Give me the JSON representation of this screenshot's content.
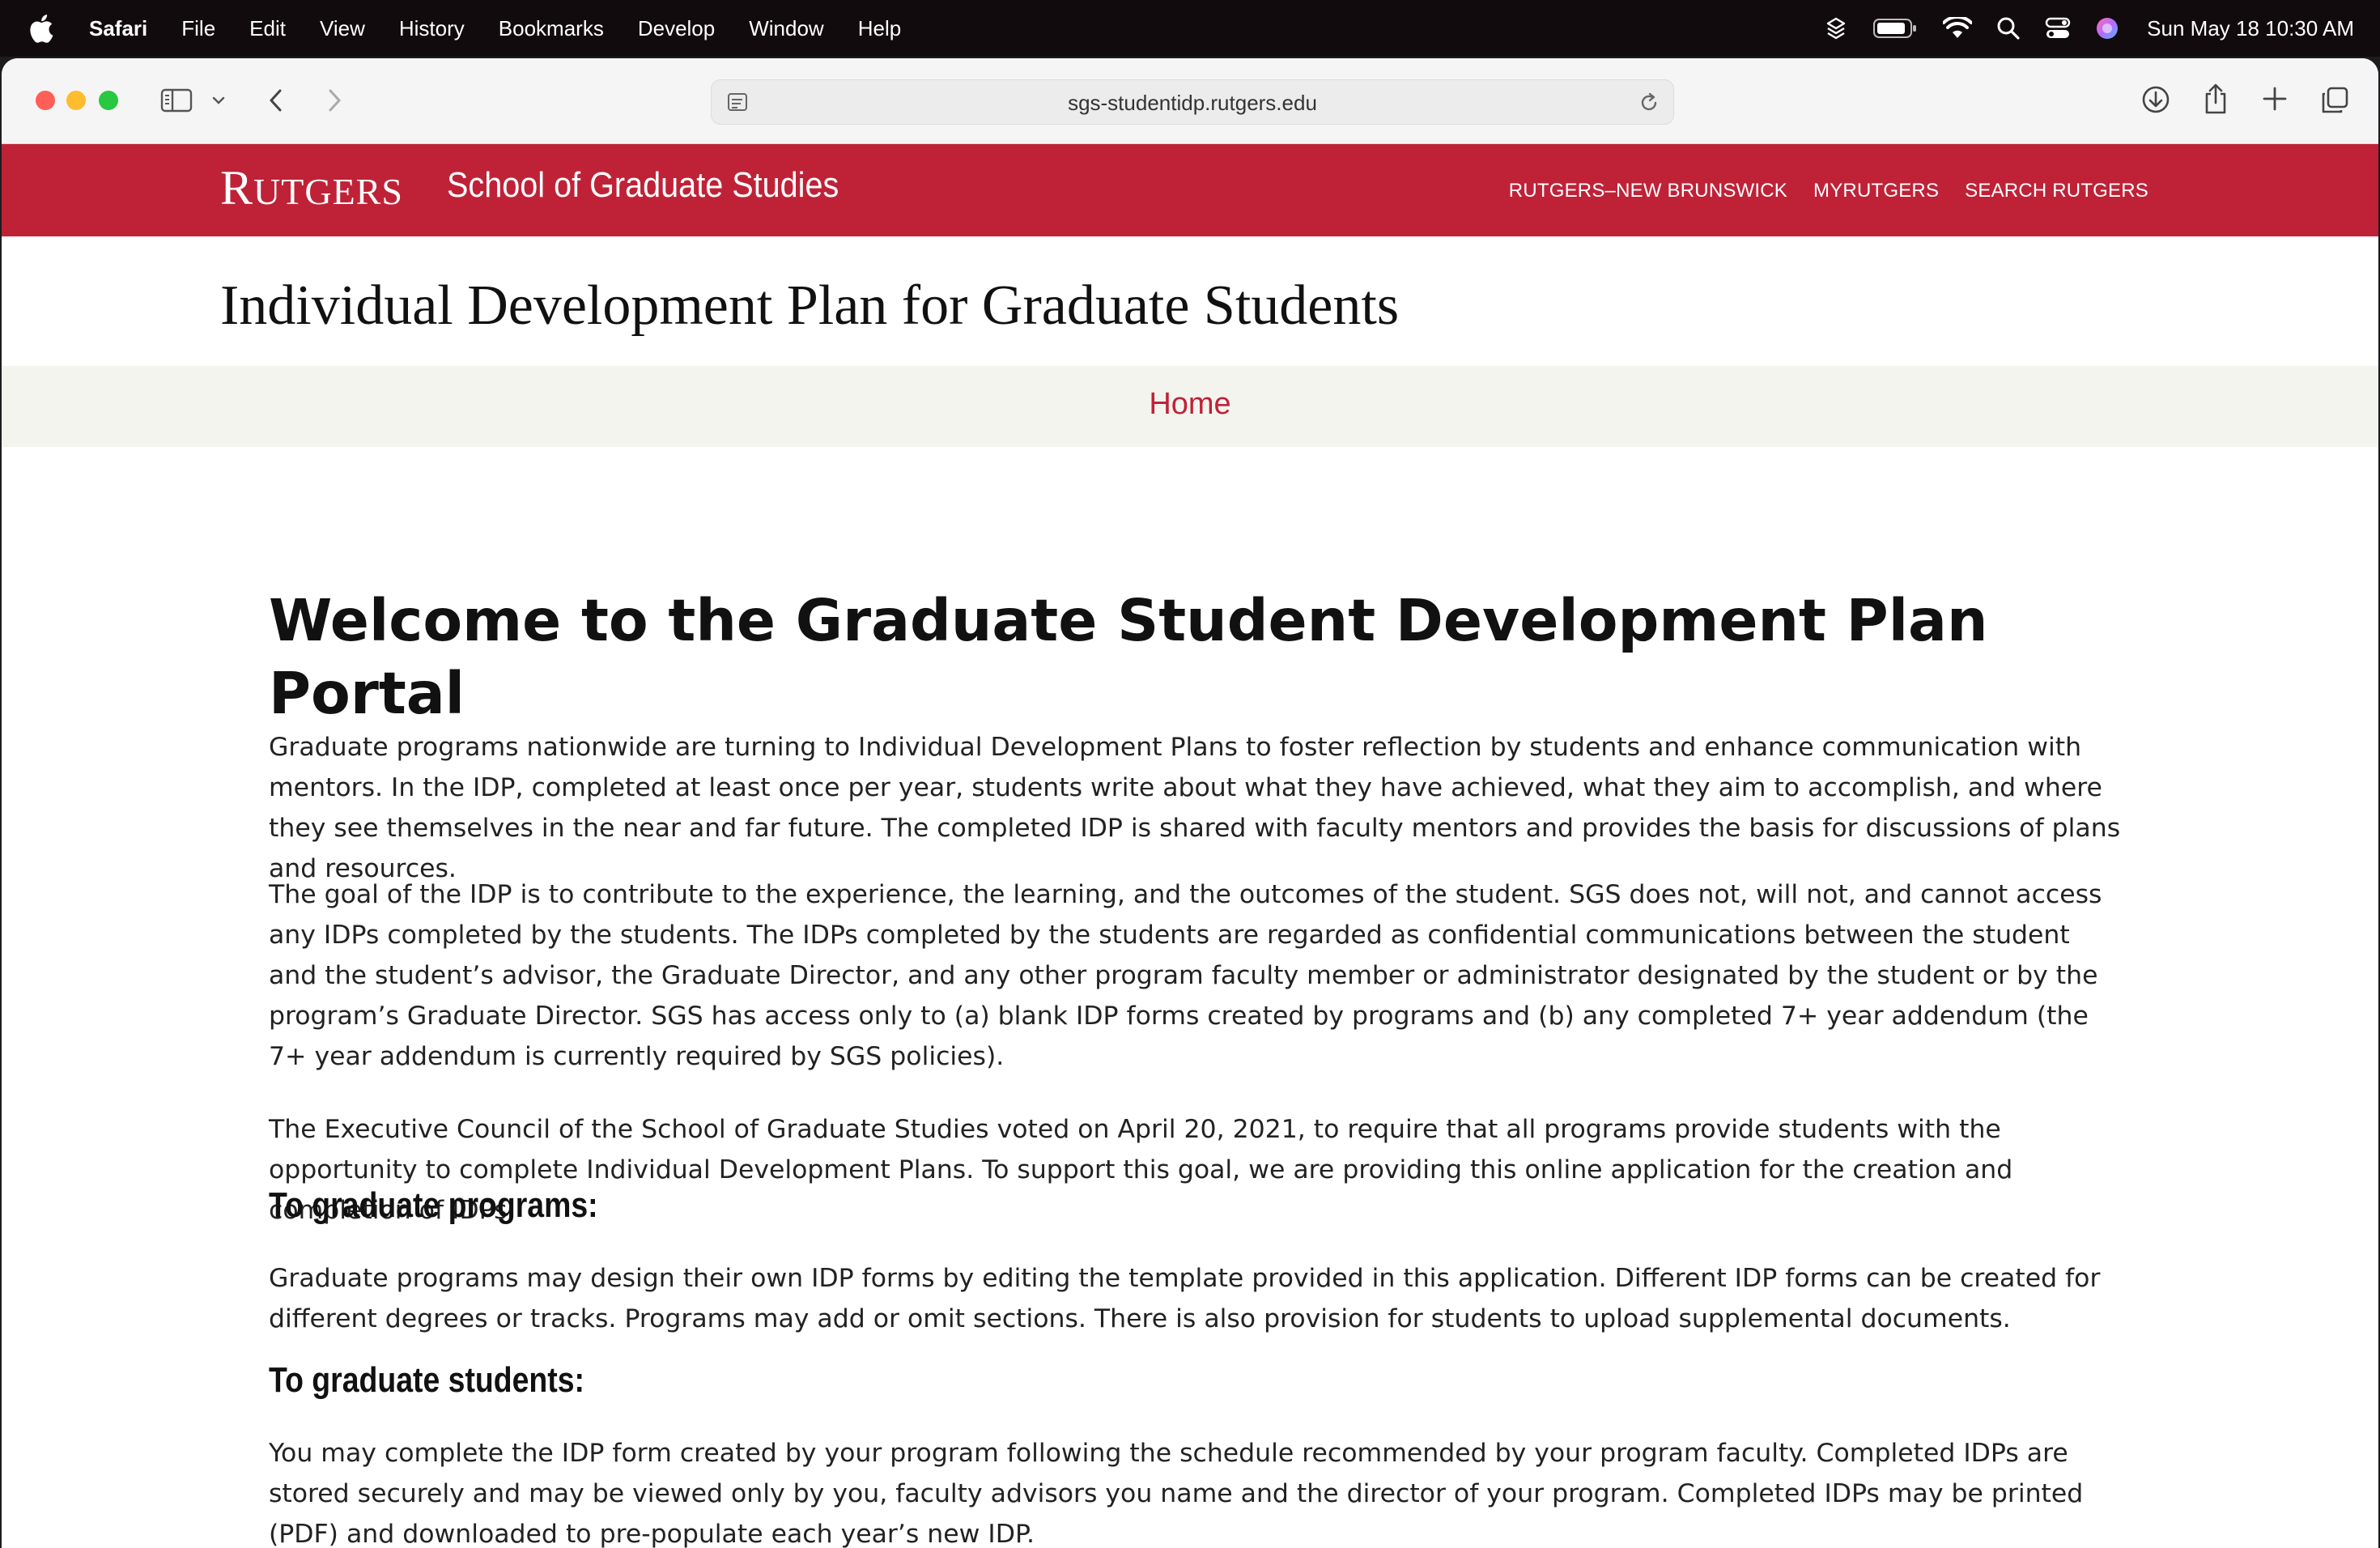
{
  "menubar": {
    "app": "Safari",
    "items": [
      "File",
      "Edit",
      "View",
      "History",
      "Bookmarks",
      "Develop",
      "Window",
      "Help"
    ],
    "clock": "Sun May 18  10:30 AM"
  },
  "browser": {
    "url": "sgs-studentidp.rutgers.edu"
  },
  "header": {
    "logo": "RUTGERS",
    "school": "School of Graduate Studies",
    "links": [
      "RUTGERS–NEW BRUNSWICK",
      "MYRUTGERS",
      "SEARCH RUTGERS"
    ],
    "page_title": "Individual Development Plan for Graduate Students",
    "nav_home": "Home",
    "brand_color": "#bf2237"
  },
  "main": {
    "heading": "Welcome to the Graduate Student Development Plan Portal",
    "paragraphs": [
      "Graduate programs nationwide are turning to Individual Development Plans to foster reflection by students and enhance communication with mentors. In the IDP, completed at least once per year, students write about what they have achieved, what they aim to accomplish, and where they see themselves in the near and far future. The completed IDP is shared with faculty mentors and provides the basis for discussions of plans and resources.",
      "The goal of the IDP is to contribute to the experience, the learning, and the outcomes of the student. SGS does not, will not, and cannot access any IDPs completed by the students. The IDPs completed by the students are regarded as confidential communications between the student and the student’s advisor, the Graduate Director, and any other program faculty member or administrator designated by the student or by the program’s Graduate Director. SGS has access only to (a) blank IDP forms created by programs and (b) any completed 7+ year addendum (the 7+ year addendum is currently required by SGS policies).",
      "The Executive Council of the School of Graduate Studies voted on April 20, 2021, to require that all programs provide students with the opportunity to complete Individual Development Plans. To support this goal, we are providing this online application for the creation and completion of IDPs."
    ],
    "programs_heading": "To graduate programs:",
    "programs_text": "Graduate programs may design their own IDP forms by editing the template provided in this application. Different IDP forms can be created for different degrees or tracks. Programs may add or omit sections. There is also provision for students to upload supplemental documents.",
    "students_heading": "To graduate students:",
    "students_text": "You may complete the IDP form created by your program following the schedule recommended by your program faculty. Completed IDPs are stored securely and may be viewed only by you, faculty advisors you name and the director of your program. Completed IDPs may be printed (PDF) and downloaded to pre-populate each year’s new IDP."
  }
}
